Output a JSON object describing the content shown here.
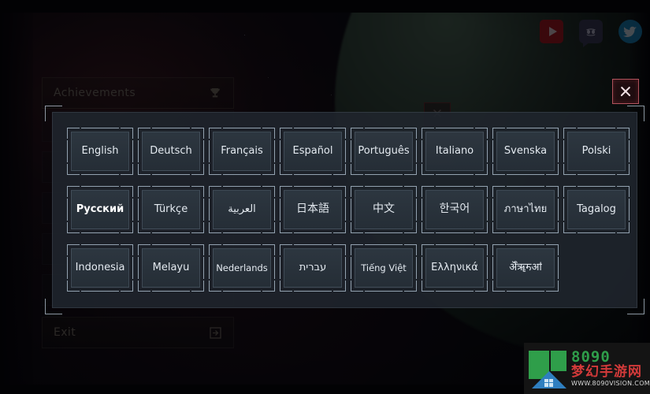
{
  "background": {
    "scene": "space-nebula-planet",
    "nebula_color": "#582226",
    "planet_color": "#56745c"
  },
  "socials": [
    {
      "name": "youtube-icon",
      "label": "YouTube",
      "color": "#b4121b"
    },
    {
      "name": "discord-icon",
      "label": "Discord",
      "color": "#3d3c58"
    },
    {
      "name": "twitter-icon",
      "label": "Twitter",
      "color": "#1789c2"
    }
  ],
  "left_menu": {
    "achievements": {
      "label": "Achievements",
      "icon": "trophy-icon"
    },
    "exit": {
      "label": "Exit",
      "icon": "exit-arrow-icon"
    }
  },
  "close_button": {
    "icon": "close-x-icon",
    "label": "Close",
    "color": "#b0525c"
  },
  "ghost_close_button": {
    "icon": "close-x-icon",
    "label": "Close"
  },
  "language_panel": {
    "selected": "Русский",
    "languages": [
      "English",
      "Deutsch",
      "Français",
      "Español",
      "Português",
      "Italiano",
      "Svenska",
      "Polski",
      "Русский",
      "Türkçe",
      "العربية",
      "日本語",
      "中文",
      "한국어",
      "ภาษาไทย",
      "Tagalog",
      "Indonesia",
      "Melayu",
      "Nederlands",
      "עברית",
      "Tiếng Việt",
      "Ελληνικά",
      "ऄऀॠॸॴ"
    ]
  },
  "watermark": {
    "number": "8090",
    "chinese": "梦幻手游网",
    "url": "WWW.8090VISION.COM"
  }
}
